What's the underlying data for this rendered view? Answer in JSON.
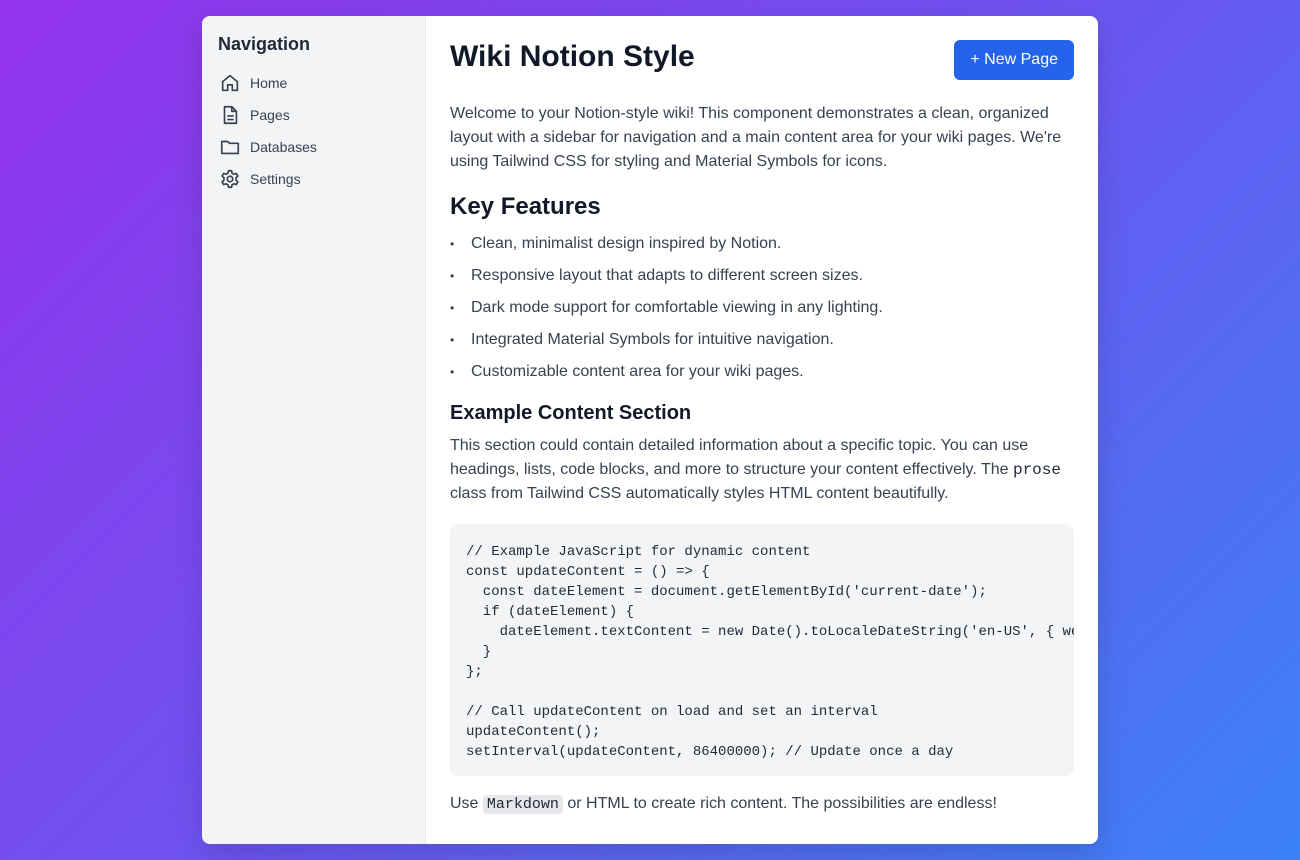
{
  "sidebar": {
    "title": "Navigation",
    "items": [
      {
        "label": "Home",
        "icon": "home-icon"
      },
      {
        "label": "Pages",
        "icon": "document-icon"
      },
      {
        "label": "Databases",
        "icon": "folder-icon"
      },
      {
        "label": "Settings",
        "icon": "gear-icon"
      }
    ]
  },
  "header": {
    "title": "Wiki Notion Style",
    "new_page_label": "+ New Page"
  },
  "content": {
    "intro": "Welcome to your Notion-style wiki! This component demonstrates a clean, organized layout with a sidebar for navigation and a main content area for your wiki pages. We're using Tailwind CSS for styling and Material Symbols for icons.",
    "features_heading": "Key Features",
    "features": [
      "Clean, minimalist design inspired by Notion.",
      "Responsive layout that adapts to different screen sizes.",
      "Dark mode support for comfortable viewing in any lighting.",
      "Integrated Material Symbols for intuitive navigation.",
      "Customizable content area for your wiki pages."
    ],
    "example_heading": "Example Content Section",
    "example_text_before": "This section could contain detailed information about a specific topic. You can use headings, lists, code blocks, and more to structure your content effectively. The ",
    "example_code_word": "prose",
    "example_text_after": " class from Tailwind CSS automatically styles HTML content beautifully.",
    "code": "// Example JavaScript for dynamic content\nconst updateContent = () => {\n  const dateElement = document.getElementById('current-date');\n  if (dateElement) {\n    dateElement.textContent = new Date().toLocaleDateString('en-US', { weekday: 'long', year: 'numeric', month: 'long', day: 'numeric' });\n  }\n};\n\n// Call updateContent on load and set an interval\nupdateContent();\nsetInterval(updateContent, 86400000); // Update once a day",
    "footer_before": "Use ",
    "footer_chip": "Markdown",
    "footer_after": " or HTML to create rich content. The possibilities are endless!"
  },
  "colors": {
    "accent": "#2563eb",
    "sidebar_bg": "#f3f4f6",
    "code_bg": "#f3f4f6"
  }
}
